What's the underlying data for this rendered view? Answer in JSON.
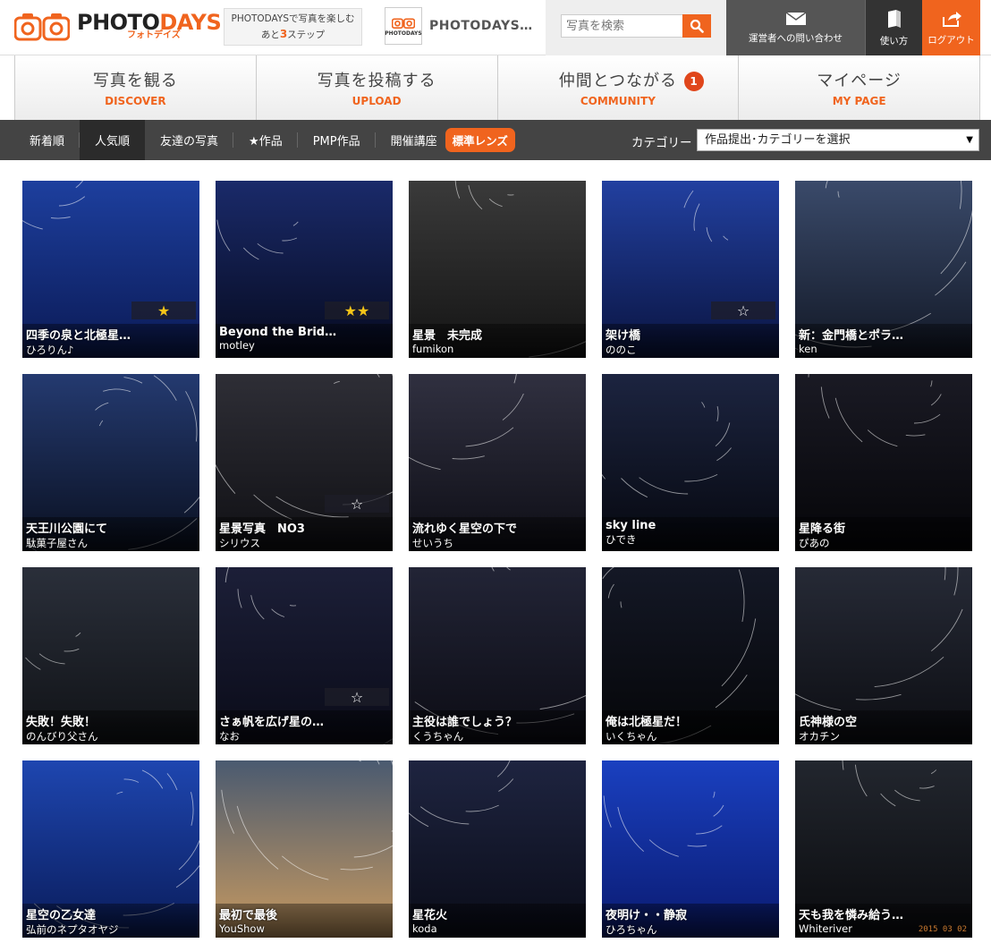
{
  "header": {
    "logo": {
      "main": "PHOTO",
      "accent": "DAYS",
      "sub": "フォトデイズ"
    },
    "steps": {
      "line1": "PHOTODAYSで写真を楽しむ",
      "prefix": "あと",
      "num": "3",
      "suffix": "ステップ"
    },
    "profile": {
      "name": "PHOTODAYS…",
      "thumb_label": "PHOTODAYS"
    },
    "search": {
      "placeholder": "写真を検索"
    },
    "contact_label": "運営者への問い合わせ",
    "help_label": "使い方",
    "logout_label": "ログアウト"
  },
  "main_nav": [
    {
      "jp": "写真を観る",
      "en": "DISCOVER"
    },
    {
      "jp": "写真を投稿する",
      "en": "UPLOAD"
    },
    {
      "jp": "仲間とつながる",
      "en": "COMMUNITY",
      "badge": "1"
    },
    {
      "jp": "マイページ",
      "en": "MY PAGE"
    }
  ],
  "sub_nav": {
    "items": [
      "新着順",
      "人気順",
      "友達の写真",
      "★作品",
      "PMP作品",
      "開催講座"
    ],
    "active_index": 1,
    "lens_tag": "標準レンズ",
    "category_label": "カテゴリー",
    "category_selected": "作品提出･カテゴリーを選択"
  },
  "colors": {
    "accent": "#f0641e",
    "star_gold": "#f5c518"
  },
  "photos": [
    {
      "title": "四季の泉と北極星…",
      "user": "ひろりん♪",
      "stars": 1,
      "empty_star": false
    },
    {
      "title": "Beyond the Brid…",
      "user": "motley",
      "stars": 2,
      "empty_star": false
    },
    {
      "title": "星景　未完成",
      "user": "fumikon",
      "stars": 0,
      "empty_star": false
    },
    {
      "title": "架け橋",
      "user": "ののこ",
      "stars": 0,
      "empty_star": true
    },
    {
      "title": "新：金門橋とポラ…",
      "user": "ken",
      "stars": 0,
      "empty_star": false
    },
    {
      "title": "天王川公園にて",
      "user": "駄菓子屋さん",
      "stars": 0,
      "empty_star": false
    },
    {
      "title": "星景写真　NO3",
      "user": "シリウス",
      "stars": 0,
      "empty_star": true
    },
    {
      "title": "流れゆく星空の下で",
      "user": "せいうち",
      "stars": 0,
      "empty_star": false
    },
    {
      "title": "sky line",
      "user": "ひでき",
      "stars": 0,
      "empty_star": false
    },
    {
      "title": "星降る街",
      "user": "ぴあの",
      "stars": 0,
      "empty_star": false
    },
    {
      "title": "失敗！失敗！",
      "user": "のんびり父さん",
      "stars": 0,
      "empty_star": false
    },
    {
      "title": "さぁ帆を広げ星の…",
      "user": "なお",
      "stars": 0,
      "empty_star": true
    },
    {
      "title": "主役は誰でしょう？",
      "user": "くうちゃん",
      "stars": 0,
      "empty_star": false
    },
    {
      "title": "俺は北極星だ！",
      "user": "いくちゃん",
      "stars": 0,
      "empty_star": false
    },
    {
      "title": "氏神様の空",
      "user": "オカチン",
      "stars": 0,
      "empty_star": false
    },
    {
      "title": "星空の乙女達",
      "user": "弘前のネプタオヤジ",
      "stars": 0,
      "empty_star": false
    },
    {
      "title": "最初で最後",
      "user": "YouShow",
      "stars": 0,
      "empty_star": false
    },
    {
      "title": "星花火",
      "user": "koda",
      "stars": 0,
      "empty_star": false
    },
    {
      "title": "夜明け・・静寂",
      "user": "ひろちゃん",
      "stars": 0,
      "empty_star": false
    },
    {
      "title": "天も我を憐み給う…",
      "user": "Whiteriver",
      "stars": 0,
      "empty_star": false,
      "datestamp": "2015 03 02"
    }
  ]
}
